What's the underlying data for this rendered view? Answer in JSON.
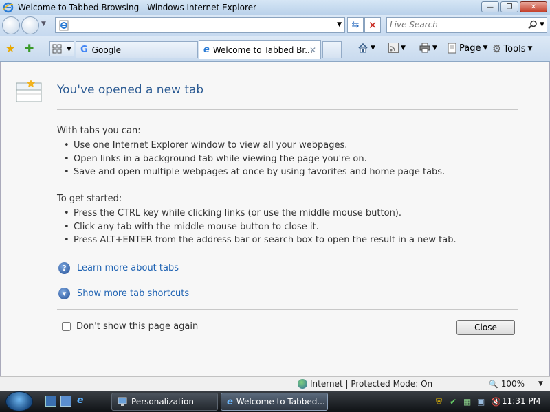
{
  "window": {
    "title": "Welcome to Tabbed Browsing - Windows Internet Explorer",
    "minimize_glyph": "—",
    "maximize_glyph": "❐",
    "close_glyph": "✕"
  },
  "address_bar": {
    "value": "",
    "dropdown_glyph": "▼",
    "refresh_glyph": "⇆",
    "stop_glyph": "✕"
  },
  "search": {
    "placeholder": "Live Search",
    "icon": "search-icon",
    "dropdown_glyph": "▼"
  },
  "tabs": [
    {
      "label": "Google",
      "active": false
    },
    {
      "label": "Welcome to Tabbed Br...",
      "active": true,
      "close_glyph": "✕"
    }
  ],
  "command_bar": {
    "page_label": "Page",
    "tools_label": "Tools",
    "dropdown_glyph": "▼"
  },
  "content": {
    "heading": "You've opened a new tab",
    "section1_title": "With tabs you can:",
    "section1_items": [
      "Use one Internet Explorer window to view all your webpages.",
      "Open links in a background tab while viewing the page you're on.",
      "Save and open multiple webpages at once by using favorites and home page tabs."
    ],
    "section2_title": "To get started:",
    "section2_items": [
      "Press the CTRL key while clicking links (or use the middle mouse button).",
      "Click any tab with the middle mouse button to close it.",
      "Press ALT+ENTER from the address bar or search box to open the result in a new tab."
    ],
    "learn_more": "Learn more about tabs",
    "show_more": "Show more tab shortcuts",
    "dont_show": "Don't show this page again",
    "close_button": "Close",
    "help_glyph": "?",
    "expand_glyph": "▾"
  },
  "status_bar": {
    "zone": "Internet | Protected Mode: On",
    "zoom": "100%",
    "zoom_glyph": "🔍",
    "dropdown_glyph": "▼"
  },
  "taskbar": {
    "buttons": [
      {
        "label": "Personalization"
      },
      {
        "label": "Welcome to Tabbed..."
      }
    ],
    "clock": "11:31 PM",
    "ie_glyph": "e"
  },
  "colors": {
    "heading": "#2c5b93",
    "link": "#1f63b3",
    "chrome": "#c8daee"
  }
}
